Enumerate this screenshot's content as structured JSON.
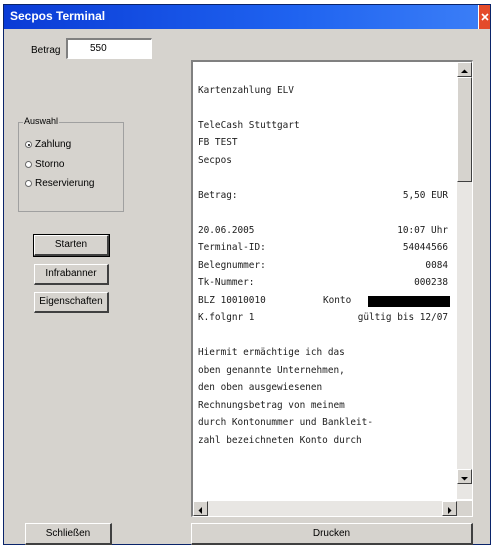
{
  "window": {
    "title": "Secpos Terminal"
  },
  "amount": {
    "label": "Betrag",
    "value": "550"
  },
  "mode_group": {
    "title": "Auswahl",
    "options": [
      {
        "label": "Zahlung",
        "selected": true
      },
      {
        "label": "Storno",
        "selected": false
      },
      {
        "label": "Reservierung",
        "selected": false
      }
    ]
  },
  "buttons": {
    "start": "Starten",
    "info": "Infrabanner",
    "properties": "Eigenschaften",
    "close": "Schließen",
    "print": "Drucken"
  },
  "receipt": {
    "lines": [
      {
        "text": ""
      },
      {
        "text": "Kartenzahlung ELV"
      },
      {
        "text": ""
      },
      {
        "text": "TeleCash Stuttgart"
      },
      {
        "text": "FB TEST"
      },
      {
        "text": "Secpos"
      },
      {
        "text": ""
      },
      {
        "text": "Betrag:",
        "right": "5,50 EUR"
      },
      {
        "text": ""
      },
      {
        "text": "20.06.2005",
        "right": "10:07 Uhr"
      },
      {
        "text": "Terminal-ID:",
        "right": "54044566"
      },
      {
        "text": "Belegnummer:",
        "right": "0084"
      },
      {
        "text": "Tk-Nummer:",
        "right": "000238"
      },
      {
        "text": "BLZ 10010010",
        "mid": "Konto",
        "redacted": true
      },
      {
        "text": "K.folgnr 1",
        "right": "gültig bis 12/07"
      },
      {
        "text": ""
      },
      {
        "text": "Hiermit ermächtige ich das"
      },
      {
        "text": "oben genannte Unternehmen,"
      },
      {
        "text": "den oben ausgewiesenen"
      },
      {
        "text": "Rechnungsbetrag von meinem"
      },
      {
        "text": "durch Kontonummer und Bankleit-"
      },
      {
        "text": "zahl bezeichneten Konto durch"
      }
    ]
  },
  "icons": {
    "close": "close-icon",
    "scroll_up": "arrow-up-icon",
    "scroll_down": "arrow-down-icon",
    "scroll_left": "arrow-left-icon",
    "scroll_right": "arrow-right-icon"
  },
  "colors": {
    "titlebar": "#0a3bd6",
    "close": "#e44b2a",
    "face": "#d6d3ce"
  }
}
